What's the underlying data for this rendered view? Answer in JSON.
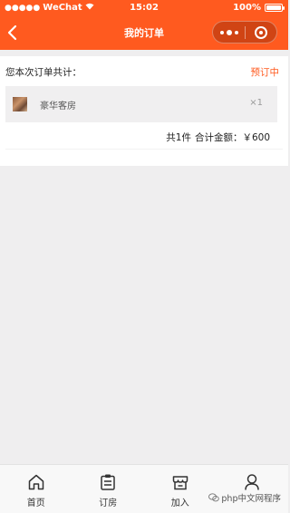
{
  "status_bar": {
    "carrier": "WeChat",
    "signal_dots": "●●●●●",
    "time": "15:02",
    "battery": "100%"
  },
  "nav": {
    "title": "我的订单",
    "back_icon": "chevron-left-icon",
    "more_icon": "more-dots-icon",
    "close_icon": "target-circle-icon"
  },
  "order": {
    "label": "您本次订单共计：",
    "status": "预订中",
    "items": [
      {
        "name": "豪华客房",
        "qty": "×1"
      }
    ],
    "count_text": "共1件",
    "total_text": "合计金额：￥600"
  },
  "tabbar": {
    "tabs": [
      {
        "label": "首页",
        "icon": "home-icon"
      },
      {
        "label": "订房",
        "icon": "clipboard-icon"
      },
      {
        "label": "加入",
        "icon": "store-icon"
      },
      {
        "label": "",
        "icon": "person-icon"
      }
    ]
  },
  "watermark": {
    "text": "php中文网程序"
  },
  "colors": {
    "brand": "#ff5a1f",
    "background": "#efeeef"
  }
}
